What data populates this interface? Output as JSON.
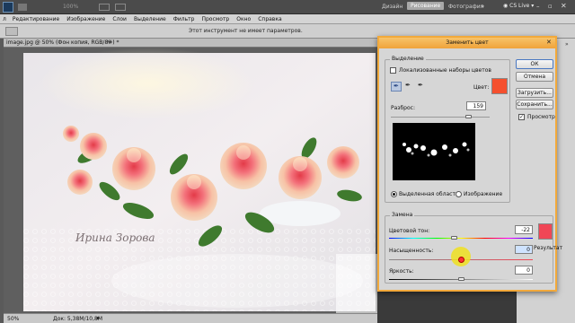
{
  "app": {
    "zoom": "100%",
    "workspace_tabs": [
      "Дизайн",
      "Рисование",
      "Фотография"
    ],
    "cs_live": "CS Live"
  },
  "menu": [
    "Редактирование",
    "Изображение",
    "Слои",
    "Выделение",
    "Фильтр",
    "Просмотр",
    "Окно",
    "Справка"
  ],
  "options_hint": "Этот инструмент не имеет параметров.",
  "document": {
    "tab_title": "image.jpg @ 50% (Фон копия, RGB/8#) *",
    "zoom": "50%",
    "doc_size": "Док: 5,38М/10,8М",
    "signature": "Ирина Зорова"
  },
  "dialog": {
    "title": "Заменить цвет",
    "selection": {
      "legend": "Выделение",
      "localized_label": "Локализованные наборы цветов",
      "color_label": "Цвет:",
      "fuzziness_label": "Разброс:",
      "fuzziness_value": "159",
      "fuzziness_level": 0.79,
      "radio_selection": "Выделенная область",
      "radio_image": "Изображение"
    },
    "replace": {
      "legend": "Замена",
      "hue_label": "Цветовой тон:",
      "hue_value": "-22",
      "hue_level": 0.45,
      "sat_label": "Насыщенность:",
      "sat_value": "0",
      "sat_level": 0.5,
      "light_label": "Яркость:",
      "light_value": "0",
      "light_level": 0.5,
      "result_label": "Результат"
    },
    "buttons": {
      "ok": "ОК",
      "cancel": "Отмена",
      "load": "Загрузить...",
      "save": "Сохранить...",
      "preview": "Просмотр"
    }
  },
  "colors": {
    "picked": "#f5502e",
    "result": "#f04656",
    "highlight": "#f0e020",
    "titlebar": "#4b4b4b",
    "workspace_active": "#a8a8a8"
  }
}
